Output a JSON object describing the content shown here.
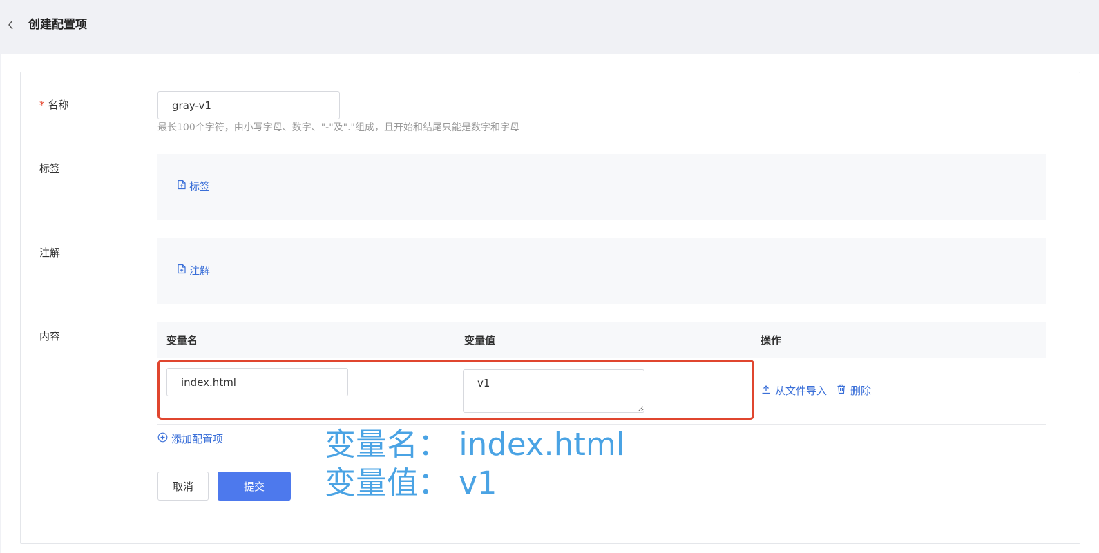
{
  "header": {
    "title": "创建配置项",
    "back_icon": "chevron-left-icon"
  },
  "form": {
    "name": {
      "required_mark": "*",
      "label": "名称",
      "value": "gray-v1",
      "help": "最长100个字符，由小写字母、数字、\"-\"及\".\"组成，且开始和结尾只能是数字和字母"
    },
    "labels": {
      "label": "标签",
      "add_label": "标签",
      "add_icon": "file-plus-icon"
    },
    "annotations": {
      "label": "注解",
      "add_label": "注解",
      "add_icon": "file-plus-icon"
    },
    "content": {
      "label": "内容",
      "columns": [
        "变量名",
        "变量值",
        "操作"
      ],
      "rows": [
        {
          "key": "index.html",
          "value": "v1",
          "import_label": "从文件导入",
          "import_icon": "upload-icon",
          "delete_label": "删除",
          "delete_icon": "trash-icon"
        }
      ],
      "add_config_label": "添加配置项",
      "add_config_icon": "plus-circle-icon"
    }
  },
  "actions": {
    "cancel": "取消",
    "submit": "提交"
  },
  "annotation_overlay": {
    "line1": "变量名： index.html",
    "line2": "变量值： v1",
    "color": "#4aa3e4",
    "highlight_color": "#e0462f"
  },
  "colors": {
    "accent": "#3a6fd8",
    "primary_button": "#4d79ed",
    "required": "#e5442c"
  }
}
